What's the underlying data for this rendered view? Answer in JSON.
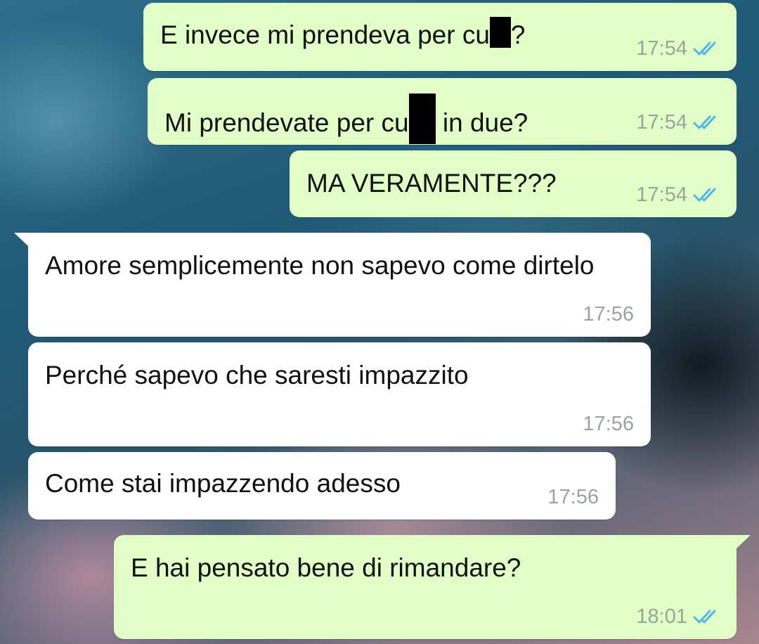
{
  "colors": {
    "outgoing_bubble": "#e1fec6",
    "incoming_bubble": "#ffffff",
    "read_ticks": "#4fb6ec",
    "timestamp": "#9aa39e"
  },
  "messages": [
    {
      "direction": "out",
      "text_before": "E invece mi prendeva per cu",
      "redacted": true,
      "text_after": "?",
      "time": "17:54",
      "status": "read"
    },
    {
      "direction": "out",
      "text_before": "Mi prendevate per cu",
      "redacted": true,
      "text_after": " in due?",
      "time": "17:54",
      "status": "read"
    },
    {
      "direction": "out",
      "text": "MA VERAMENTE???",
      "time": "17:54",
      "status": "read"
    },
    {
      "direction": "in",
      "text": "Amore semplicemente non sapevo come dirtelo",
      "time": "17:56"
    },
    {
      "direction": "in",
      "text": "Perché sapevo che saresti impazzito",
      "time": "17:56"
    },
    {
      "direction": "in",
      "text": "Come stai impazzendo adesso",
      "time": "17:56"
    },
    {
      "direction": "out",
      "text": "E hai pensato bene di rimandare?",
      "time": "18:01",
      "status": "read"
    }
  ]
}
